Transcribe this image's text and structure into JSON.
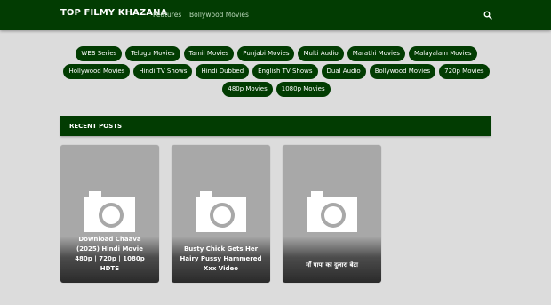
{
  "header": {
    "brand": "TOP FILMY KHAZANA",
    "nav": [
      {
        "label": "Features"
      },
      {
        "label": "Bollywood Movies"
      }
    ],
    "search_icon": "search-icon"
  },
  "labels": [
    "WEB Series",
    "Telugu Movies",
    "Tamil Movies",
    "Punjabi Movies",
    "Multi Audio",
    "Marathi Movies",
    "Malayalam Movies",
    "Hollywood Movies",
    "Hindi TV Shows",
    "Hindi Dubbed",
    "English TV Shows",
    "Dual Audio",
    "Bollywood Movies",
    "720p Movies",
    "480p Movies",
    "1080p Movies"
  ],
  "recent_posts": {
    "heading": "RECENT POSTS",
    "posts": [
      {
        "title": "Download Chaava (2025) Hindi Movie 480p | 720p | 1080p HDTS",
        "thumb_icon": "camera-icon"
      },
      {
        "title": "Busty Chick Gets Her Hairy Pussy Hammered Xxx Video",
        "thumb_icon": "camera-icon"
      },
      {
        "title": "माँ पापा का दुलारा बेटा",
        "thumb_icon": "camera-icon"
      }
    ]
  },
  "colors": {
    "primary": "#023c02",
    "background": "#dcdcdc",
    "thumb_placeholder": "#a8a8a8"
  }
}
